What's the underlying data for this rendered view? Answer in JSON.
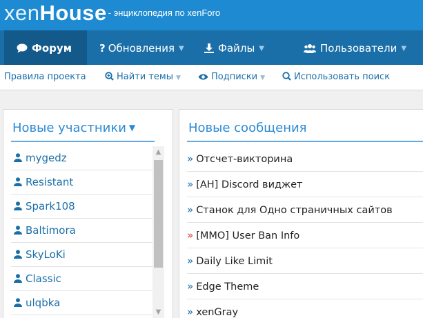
{
  "site": {
    "logo_thin": "xen",
    "logo_bold": "House",
    "tagline": "- энциклопедия по xenForo",
    "brand_color": "#1d8ad2"
  },
  "nav": {
    "tabs": [
      {
        "label": "Форум",
        "icon": "chat-bubble-icon",
        "active": true
      },
      {
        "label": "Обновления",
        "icon": "question-icon",
        "active": false
      },
      {
        "label": "Файлы",
        "icon": "download-icon",
        "active": false
      },
      {
        "label": "Пользователи",
        "icon": "users-icon",
        "active": false
      }
    ]
  },
  "subnav": {
    "items": [
      {
        "label": "Правила проекта"
      },
      {
        "label": "Найти темы",
        "icon": "search-plus-icon"
      },
      {
        "label": "Подписки",
        "icon": "eye-icon"
      },
      {
        "label": "Использовать поиск",
        "icon": "search-icon"
      }
    ]
  },
  "members_panel": {
    "title": "Новые участники",
    "members": [
      "mygedz",
      "Resistant",
      "Spark108",
      "Baltimora",
      "SkyLoKi",
      "Classic",
      "ulqbka"
    ]
  },
  "posts_panel": {
    "title": "Новые сообщения",
    "posts": [
      {
        "title": "Отсчет-викторина",
        "hot": false
      },
      {
        "title": "[AH] Discord виджет",
        "hot": false
      },
      {
        "title": "Станок для Одно страничных сайтов",
        "hot": false
      },
      {
        "title": "[MMO] User Ban Info",
        "hot": true
      },
      {
        "title": "Daily Like Limit",
        "hot": false
      },
      {
        "title": "Edge Theme",
        "hot": false
      },
      {
        "title": "xenGray",
        "hot": false
      }
    ]
  }
}
